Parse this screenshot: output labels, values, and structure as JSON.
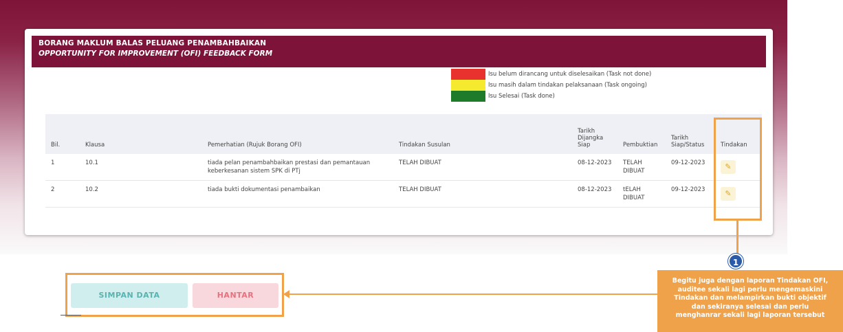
{
  "form": {
    "title_ms": "BORANG MAKLUM BALAS PELUANG PENAMBAHBAIKAN",
    "title_en": "OPPORTUNITY FOR IMPROVEMENT (OFI) FEEDBACK FORM"
  },
  "legend": {
    "items": [
      {
        "color": "#e8322d",
        "label": "Isu belum dirancang untuk diselesaikan (Task not done)"
      },
      {
        "color": "#f5ea2e",
        "label": "Isu masih dalam tindakan pelaksanaan (Task ongoing)"
      },
      {
        "color": "#1e7b2a",
        "label": "Isu Selesai (Task done)"
      }
    ]
  },
  "table": {
    "headers": {
      "bil": "Bil.",
      "klausa": "Klausa",
      "pemerhatian": "Pemerhatian (Rujuk Borang OFI)",
      "tindakan_susulan": "Tindakan Susulan",
      "tarikh_dijangka": "Tarikh Dijangka Siap",
      "pembuktian": "Pembuktian",
      "tarikh_siap": "Tarikh Siap/Status",
      "tindakan": "Tindakan"
    },
    "rows": [
      {
        "bil": "1",
        "klausa": "10.1",
        "pemerhatian": "tiada pelan penambahbaikan prestasi dan pemantauan keberkesanan sistem SPK di PTj",
        "tindakan_susulan": "TELAH DIBUAT",
        "tarikh_dijangka": "08-12-2023",
        "pembuktian": "TELAH DIBUAT",
        "tarikh_siap": "09-12-2023",
        "action_icon": "pencil-icon"
      },
      {
        "bil": "2",
        "klausa": "10.2",
        "pemerhatian": "tiada bukti dokumentasi penambaikan",
        "tindakan_susulan": "TELAH DIBUAT",
        "tarikh_dijangka": "08-12-2023",
        "pembuktian": "tELAH DIBUAT",
        "tarikh_siap": "09-12-2023",
        "action_icon": "pencil-icon"
      }
    ]
  },
  "buttons": {
    "simpan": "SIMPAN DATA",
    "hantar": "HANTAR"
  },
  "annotation": {
    "badge": "1",
    "callout_lines": [
      "Begitu juga dengan laporan Tindakan OFI,",
      "auditee sekali lagi perlu mengemaskini",
      "Tindakan dan melampirkan bukti objektif",
      "dan sekiranya selesai dan perlu",
      "menghanrar sekali lagi laporan tersebut"
    ],
    "highlight_color": "#f0a24a"
  }
}
